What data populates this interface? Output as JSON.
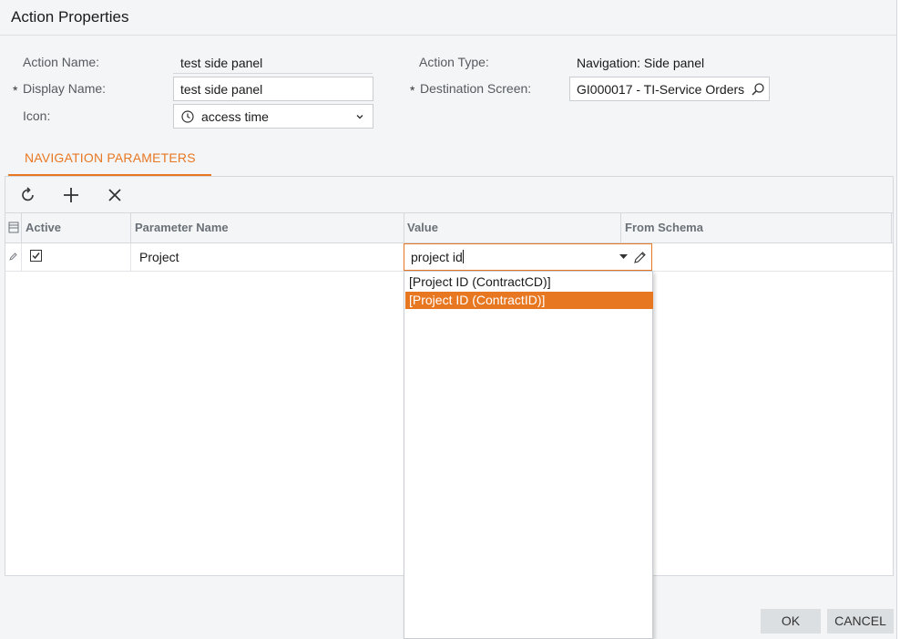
{
  "dialog": {
    "title": "Action Properties"
  },
  "form": {
    "action_name_label": "Action Name:",
    "action_name_value": "test side panel",
    "display_name_label": "Display Name:",
    "display_name_value": "test side panel",
    "icon_label": "Icon:",
    "icon_value": "access time",
    "action_type_label": "Action Type:",
    "action_type_value": "Navigation: Side panel",
    "destination_label": "Destination Screen:",
    "destination_value": "GI000017 - TI-Service Orders",
    "required_mark": "*"
  },
  "tabs": [
    {
      "label": "NAVIGATION PARAMETERS",
      "active": true
    }
  ],
  "grid": {
    "columns": [
      "Active",
      "Parameter Name",
      "Value",
      "From Schema"
    ],
    "rows": [
      {
        "active": true,
        "parameter_name": "Project",
        "value": "project id",
        "from_schema": ""
      }
    ]
  },
  "value_dropdown": {
    "options": [
      "[Project ID (ContractCD)]",
      "[Project ID (ContractID)]"
    ],
    "selected_index": 1
  },
  "footer": {
    "ok_label": "OK",
    "cancel_label": "CANCEL"
  },
  "colors": {
    "accent": "#e87722",
    "border": "#d5d8dc",
    "background": "#f4f5f6"
  }
}
